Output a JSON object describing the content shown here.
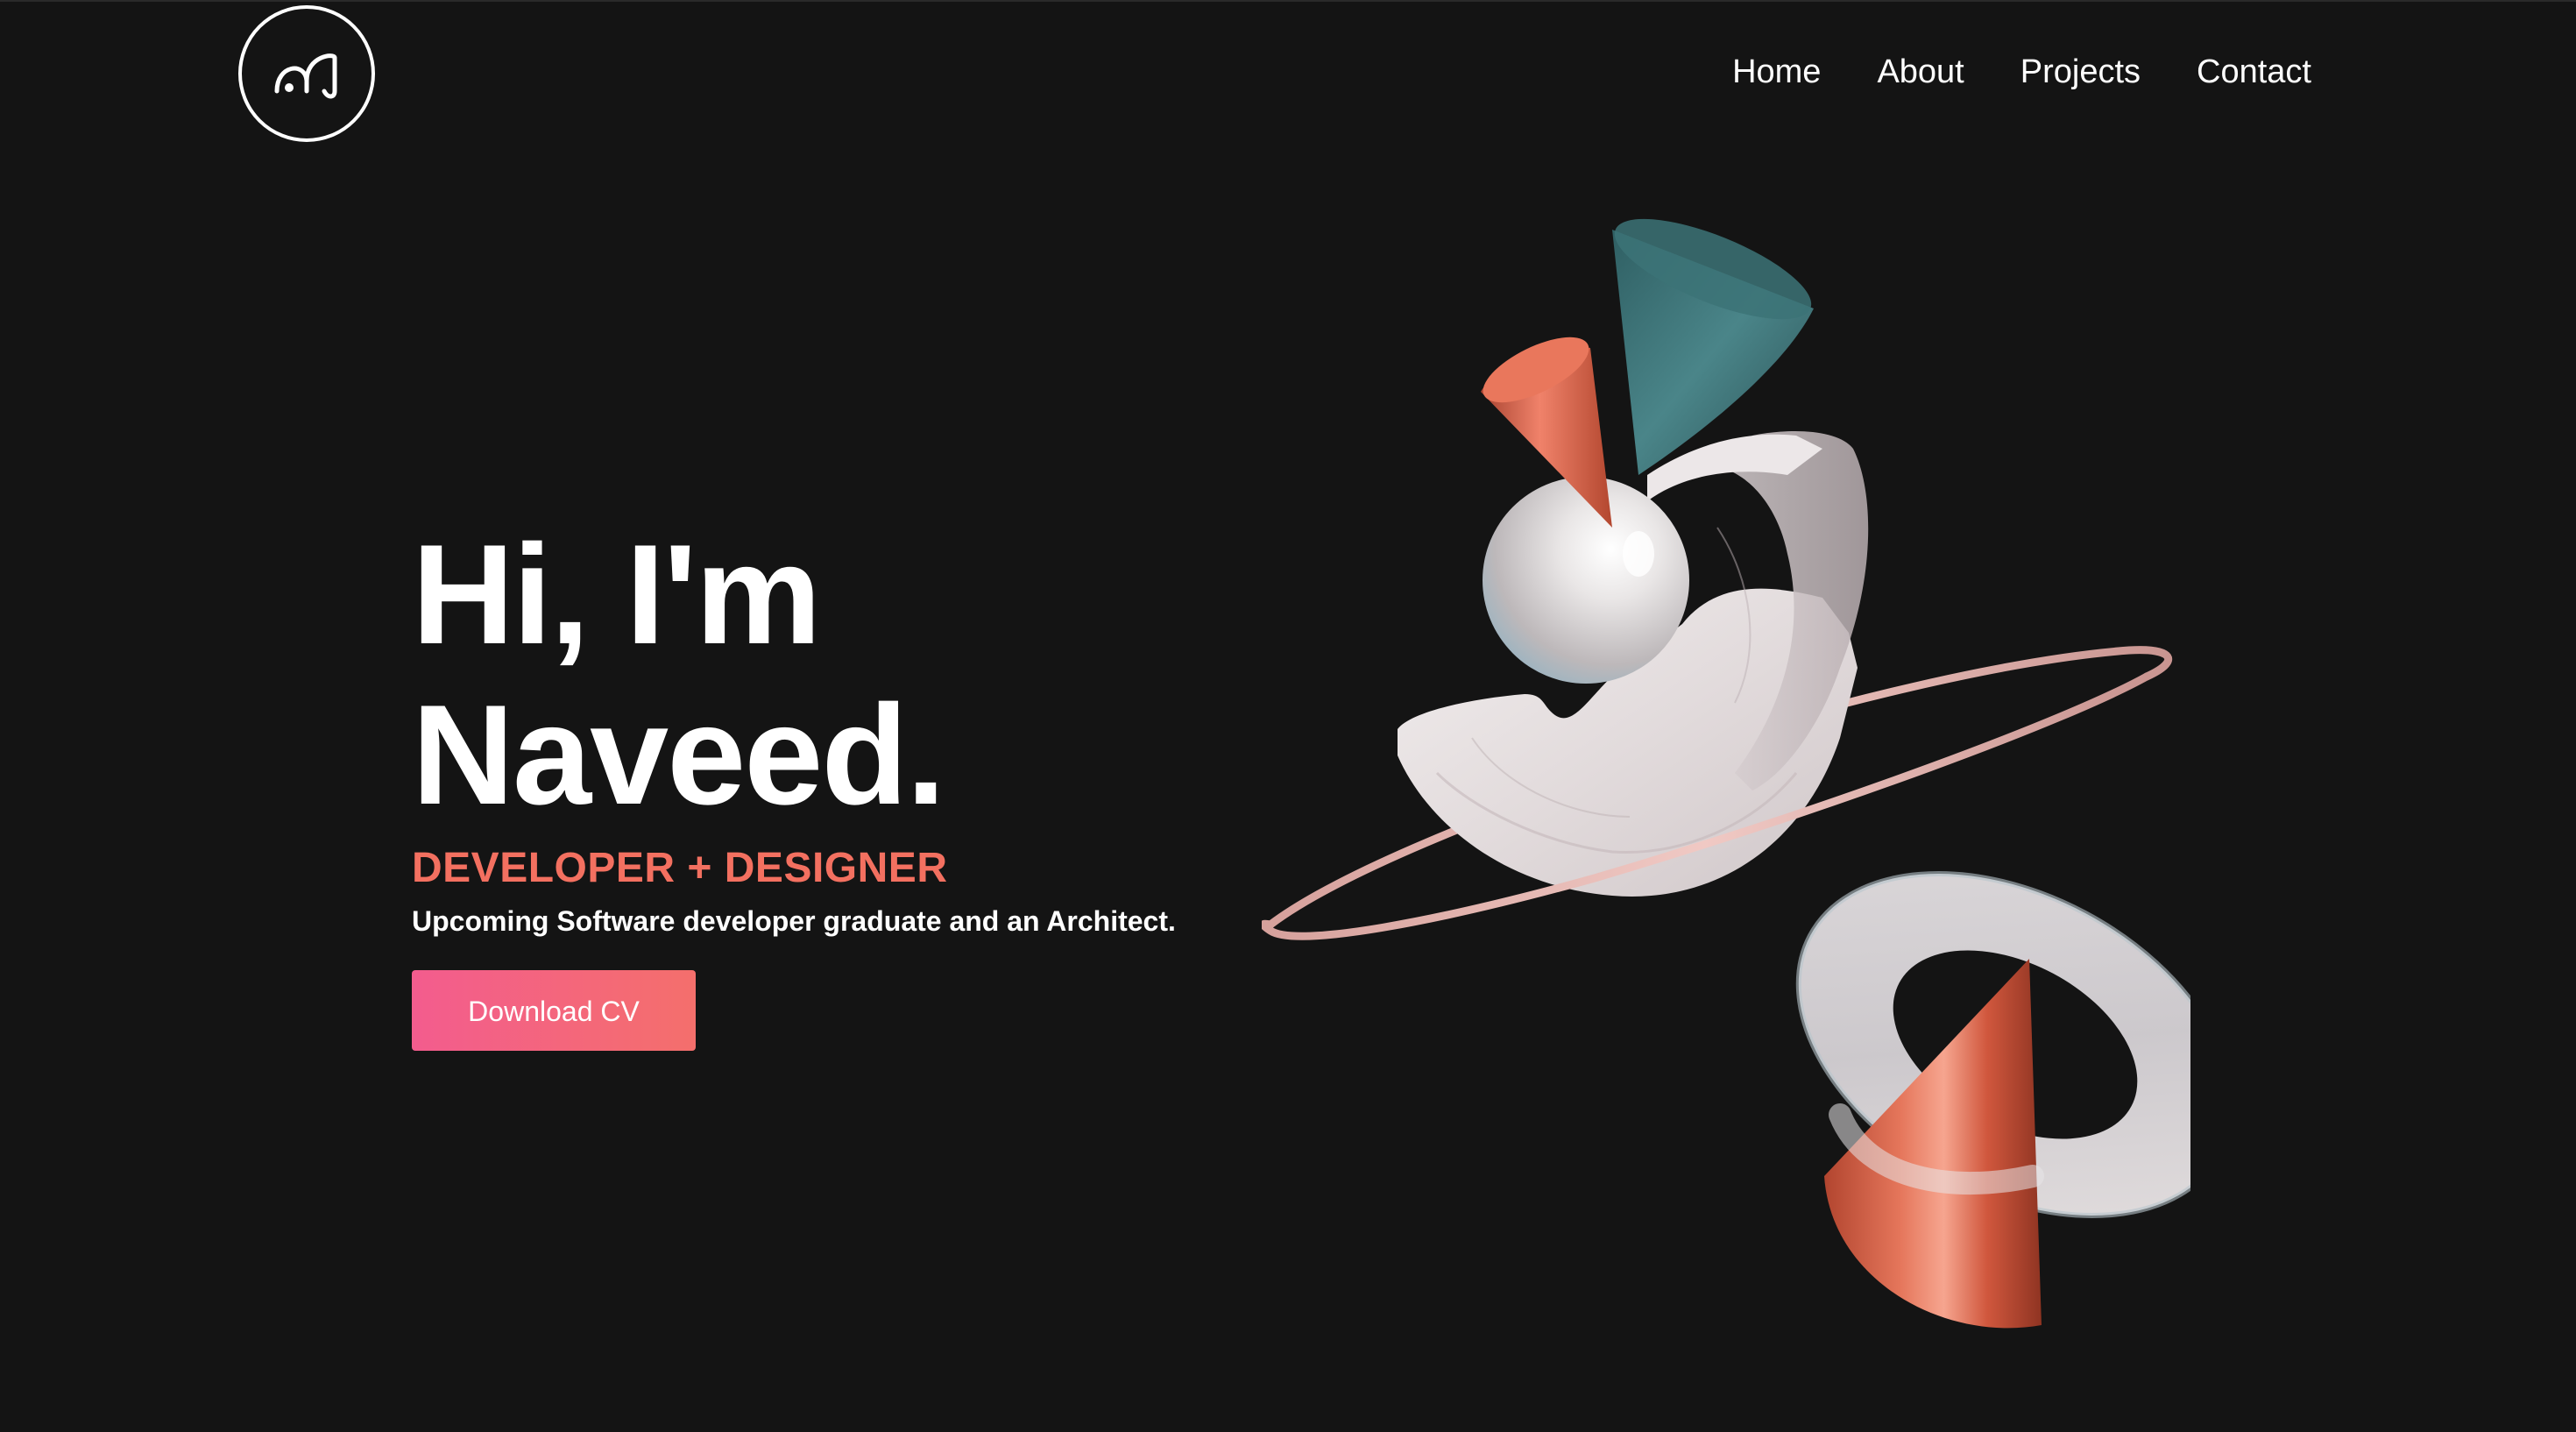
{
  "header": {
    "logo_name": "NJ monogram logo",
    "nav": [
      {
        "label": "Home"
      },
      {
        "label": "About"
      },
      {
        "label": "Projects"
      },
      {
        "label": "Contact"
      }
    ]
  },
  "hero": {
    "title_line1": "Hi, I'm",
    "title_line2": "Naveed.",
    "subtitle": "DEVELOPER + DESIGNER",
    "description": "Upcoming Software developer graduate and an Architect.",
    "cv_button": "Download CV"
  },
  "colors": {
    "background": "#141414",
    "accent": "#f37060",
    "button_start": "#f35c8e",
    "button_end": "#f46f6c",
    "copper": "#d9654b",
    "teal": "#3e7478"
  }
}
